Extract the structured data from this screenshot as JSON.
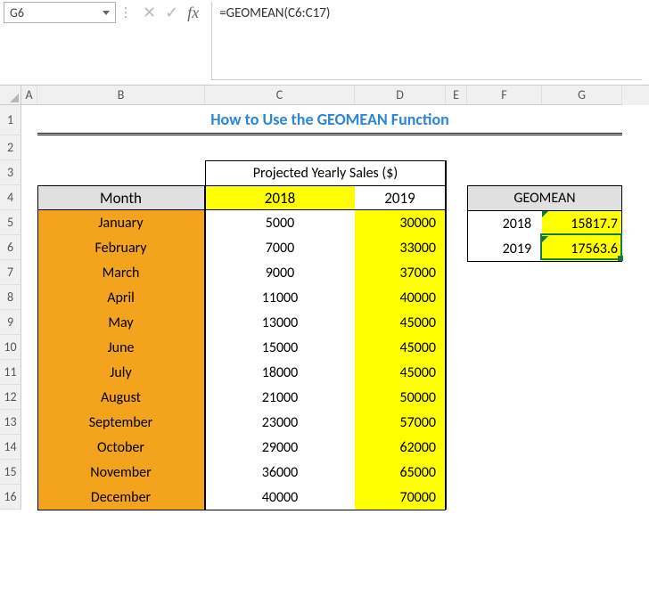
{
  "nameBox": "G6",
  "formula": "=GEOMEAN(C6:C17)",
  "title": "How to Use the GEOMEAN Function",
  "columns": [
    "A",
    "B",
    "C",
    "D",
    "E",
    "F",
    "G"
  ],
  "rows": [
    "1",
    "2",
    "3",
    "4",
    "5",
    "6",
    "7",
    "8",
    "9",
    "10",
    "11",
    "12",
    "13",
    "14",
    "15",
    "16"
  ],
  "table": {
    "projHeader": "Projected Yearly Sales ($)",
    "headers": {
      "month": "Month",
      "y2018": "2018",
      "y2019": "2019"
    },
    "data": [
      {
        "month": "January",
        "y2018": "5000",
        "y2019": "30000"
      },
      {
        "month": "February",
        "y2018": "7000",
        "y2019": "33000"
      },
      {
        "month": "March",
        "y2018": "9000",
        "y2019": "37000"
      },
      {
        "month": "April",
        "y2018": "11000",
        "y2019": "40000"
      },
      {
        "month": "May",
        "y2018": "13000",
        "y2019": "45000"
      },
      {
        "month": "June",
        "y2018": "15000",
        "y2019": "45000"
      },
      {
        "month": "July",
        "y2018": "18000",
        "y2019": "45000"
      },
      {
        "month": "August",
        "y2018": "21000",
        "y2019": "50000"
      },
      {
        "month": "September",
        "y2018": "23000",
        "y2019": "57000"
      },
      {
        "month": "October",
        "y2018": "29000",
        "y2019": "62000"
      },
      {
        "month": "November",
        "y2018": "36000",
        "y2019": "65000"
      },
      {
        "month": "December",
        "y2018": "40000",
        "y2019": "70000"
      }
    ]
  },
  "geomean": {
    "header": "GEOMEAN",
    "rows": [
      {
        "year": "2018",
        "value": "15817.7"
      },
      {
        "year": "2019",
        "value": "17563.6"
      }
    ]
  }
}
